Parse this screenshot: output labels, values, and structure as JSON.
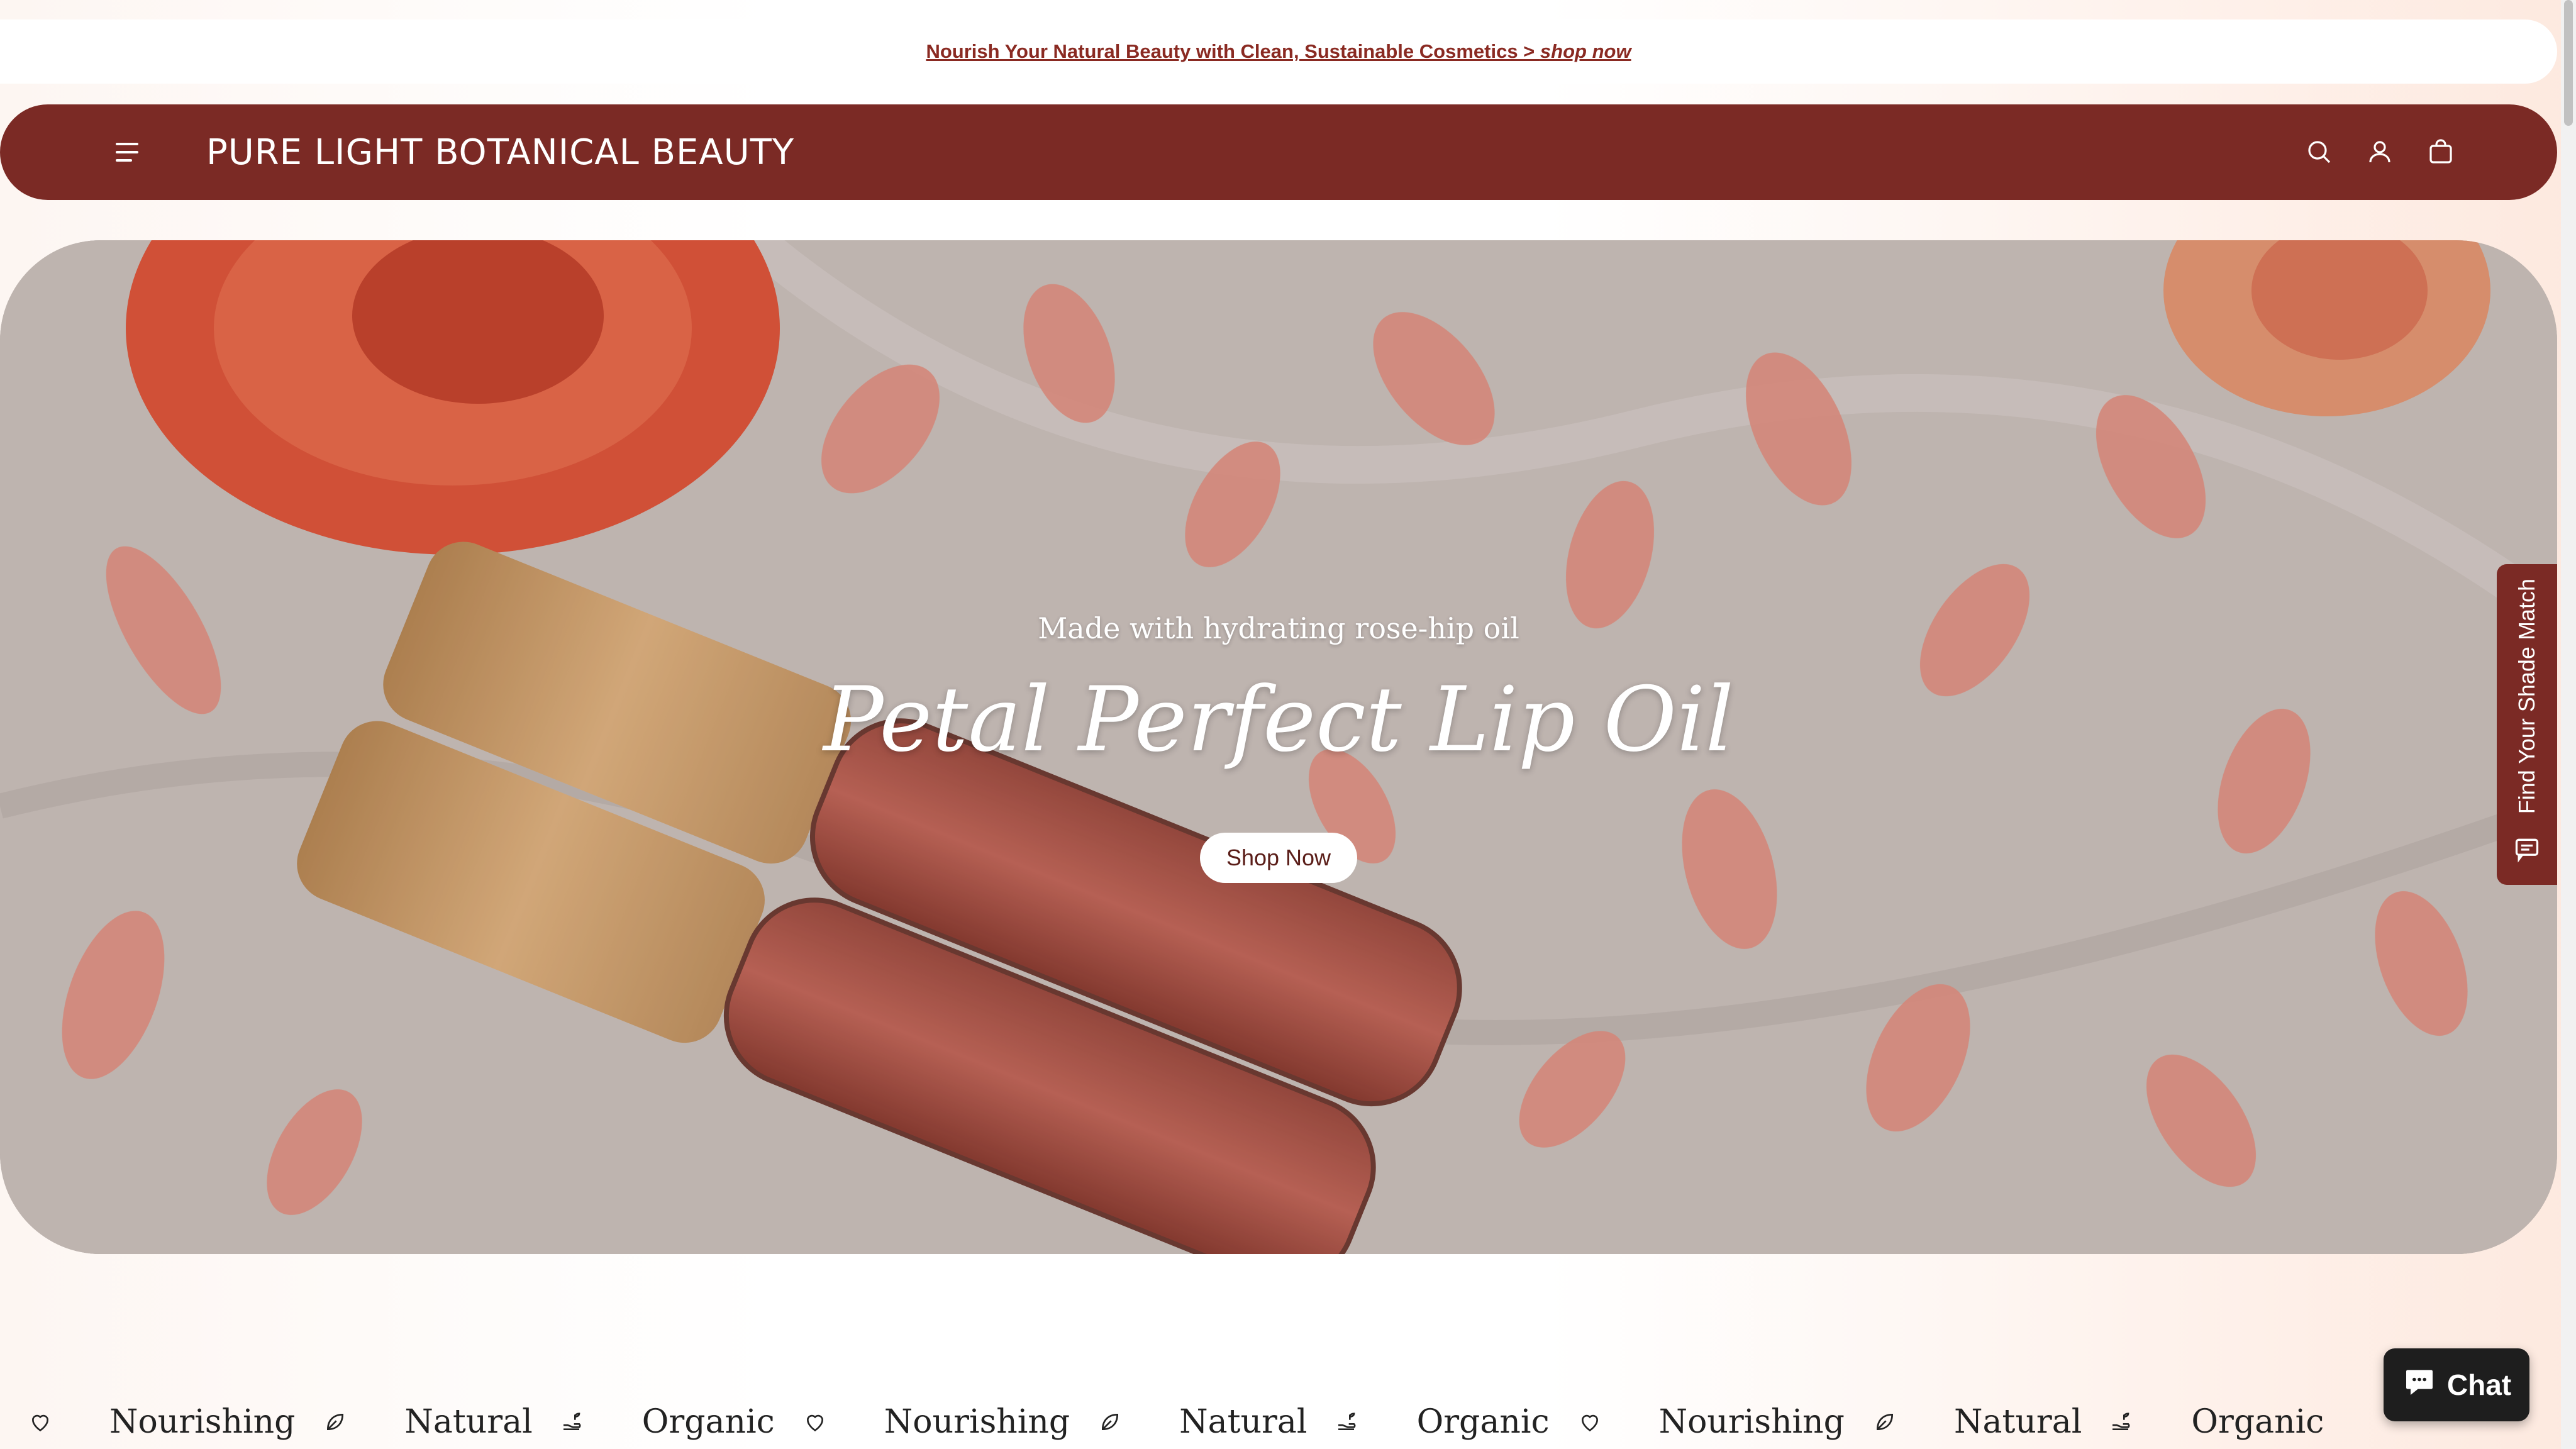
{
  "announcement": {
    "text": "Nourish Your Natural Beauty with Clean, Sustainable Cosmetics > ",
    "link_text": "shop now"
  },
  "header": {
    "logo": "PURE LIGHT BOTANICAL BEAUTY",
    "icons": [
      "menu-icon",
      "search-icon",
      "account-icon",
      "cart-icon"
    ]
  },
  "hero": {
    "subtitle": "Made with hydrating rose-hip oil",
    "title": "Petal Perfect Lip Oil",
    "button": "Shop Now"
  },
  "side_tab": {
    "label": "Find Your Shade Match"
  },
  "marquee": {
    "items": [
      {
        "icon": "heart-icon",
        "word": "Nourishing"
      },
      {
        "icon": "leaf-icon",
        "word": "Natural"
      },
      {
        "icon": "hand-sprout-icon",
        "word": "Organic"
      },
      {
        "icon": "heart-icon",
        "word": "Nourishing"
      },
      {
        "icon": "leaf-icon",
        "word": "Natural"
      },
      {
        "icon": "hand-sprout-icon",
        "word": "Organic"
      },
      {
        "icon": "heart-icon",
        "word": "Nourishing"
      },
      {
        "icon": "leaf-icon",
        "word": "Natural"
      },
      {
        "icon": "hand-sprout-icon",
        "word": "Organic"
      }
    ]
  },
  "chat": {
    "label": "Chat"
  },
  "colors": {
    "brand": "#7b2a25",
    "announce_link": "#8a2a22",
    "white": "#ffffff"
  }
}
